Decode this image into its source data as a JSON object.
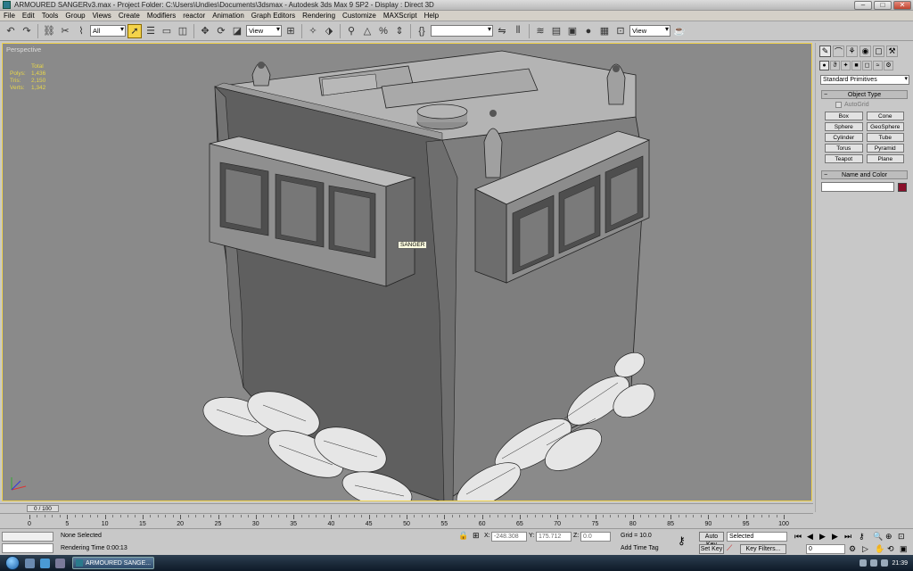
{
  "window": {
    "title": "ARMOURED SANGERv3.max    - Project Folder: C:\\Users\\Undies\\Documents\\3dsmax    - Autodesk 3ds Max 9 SP2    - Display : Direct 3D"
  },
  "menu": [
    "File",
    "Edit",
    "Tools",
    "Group",
    "Views",
    "Create",
    "Modifiers",
    "reactor",
    "Animation",
    "Graph Editors",
    "Rendering",
    "Customize",
    "MAXScript",
    "Help"
  ],
  "toolbar": {
    "selection_filter": "All",
    "ref_coord": "View",
    "named_selection": "",
    "view_right": "View"
  },
  "viewport": {
    "label": "Perspective",
    "stats": {
      "header": "Total",
      "rows": [
        {
          "k": "Polys:",
          "v": "1,436"
        },
        {
          "k": "Tris:",
          "v": "2,150"
        },
        {
          "k": "Verts:",
          "v": "1,342"
        }
      ]
    },
    "tooltip": "SANGER"
  },
  "command_panel": {
    "dropdown": "Standard Primitives",
    "object_type_title": "Object Type",
    "autogrid": "AutoGrid",
    "primitives": [
      "Box",
      "Cone",
      "Sphere",
      "GeoSphere",
      "Cylinder",
      "Tube",
      "Torus",
      "Pyramid",
      "Teapot",
      "Plane"
    ],
    "name_color_title": "Name and Color",
    "object_color": "#8a0f2a"
  },
  "timeline": {
    "slider": "0 / 100",
    "ticks": [
      0,
      5,
      10,
      15,
      20,
      25,
      30,
      35,
      40,
      45,
      50,
      55,
      60,
      65,
      70,
      75,
      80,
      85,
      90,
      95,
      100
    ]
  },
  "status": {
    "selection": "None Selected",
    "prompt": "Rendering Time  0:00:13",
    "x_label": "X:",
    "x_value": "-248.308",
    "y_label": "Y:",
    "y_value": "175.712",
    "z_label": "Z:",
    "z_value": "0.0",
    "grid": "Grid = 10.0",
    "add_time_tag": "Add Time Tag",
    "auto_key": "Auto Key",
    "set_key": "Set Key",
    "key_mode": "Selected",
    "key_filters": "Key Filters...",
    "frame": "0"
  },
  "taskbar": {
    "task": "ARMOURED SANGE...",
    "clock": "21:39"
  }
}
